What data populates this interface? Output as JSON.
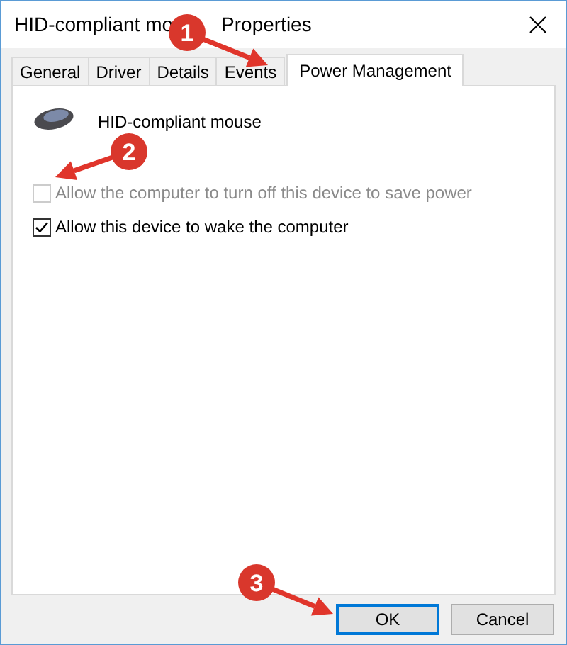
{
  "window": {
    "title_start": "HID-compliant mo",
    "title_end": "Properties"
  },
  "tabs": [
    {
      "label": "General",
      "selected": false
    },
    {
      "label": "Driver",
      "selected": false
    },
    {
      "label": "Details",
      "selected": false
    },
    {
      "label": "Events",
      "selected": false
    },
    {
      "label": "Power Management",
      "selected": true
    }
  ],
  "device": {
    "name": "HID-compliant mouse"
  },
  "options": [
    {
      "label": "Allow the computer to turn off this device to save power",
      "checked": false,
      "disabled": true
    },
    {
      "label": "Allow this device to wake the computer",
      "checked": true,
      "disabled": false
    }
  ],
  "buttons": [
    {
      "label": "OK",
      "default": true
    },
    {
      "label": "Cancel",
      "default": false
    }
  ],
  "annotations": [
    {
      "number": "1"
    },
    {
      "number": "2"
    },
    {
      "number": "3"
    }
  ]
}
